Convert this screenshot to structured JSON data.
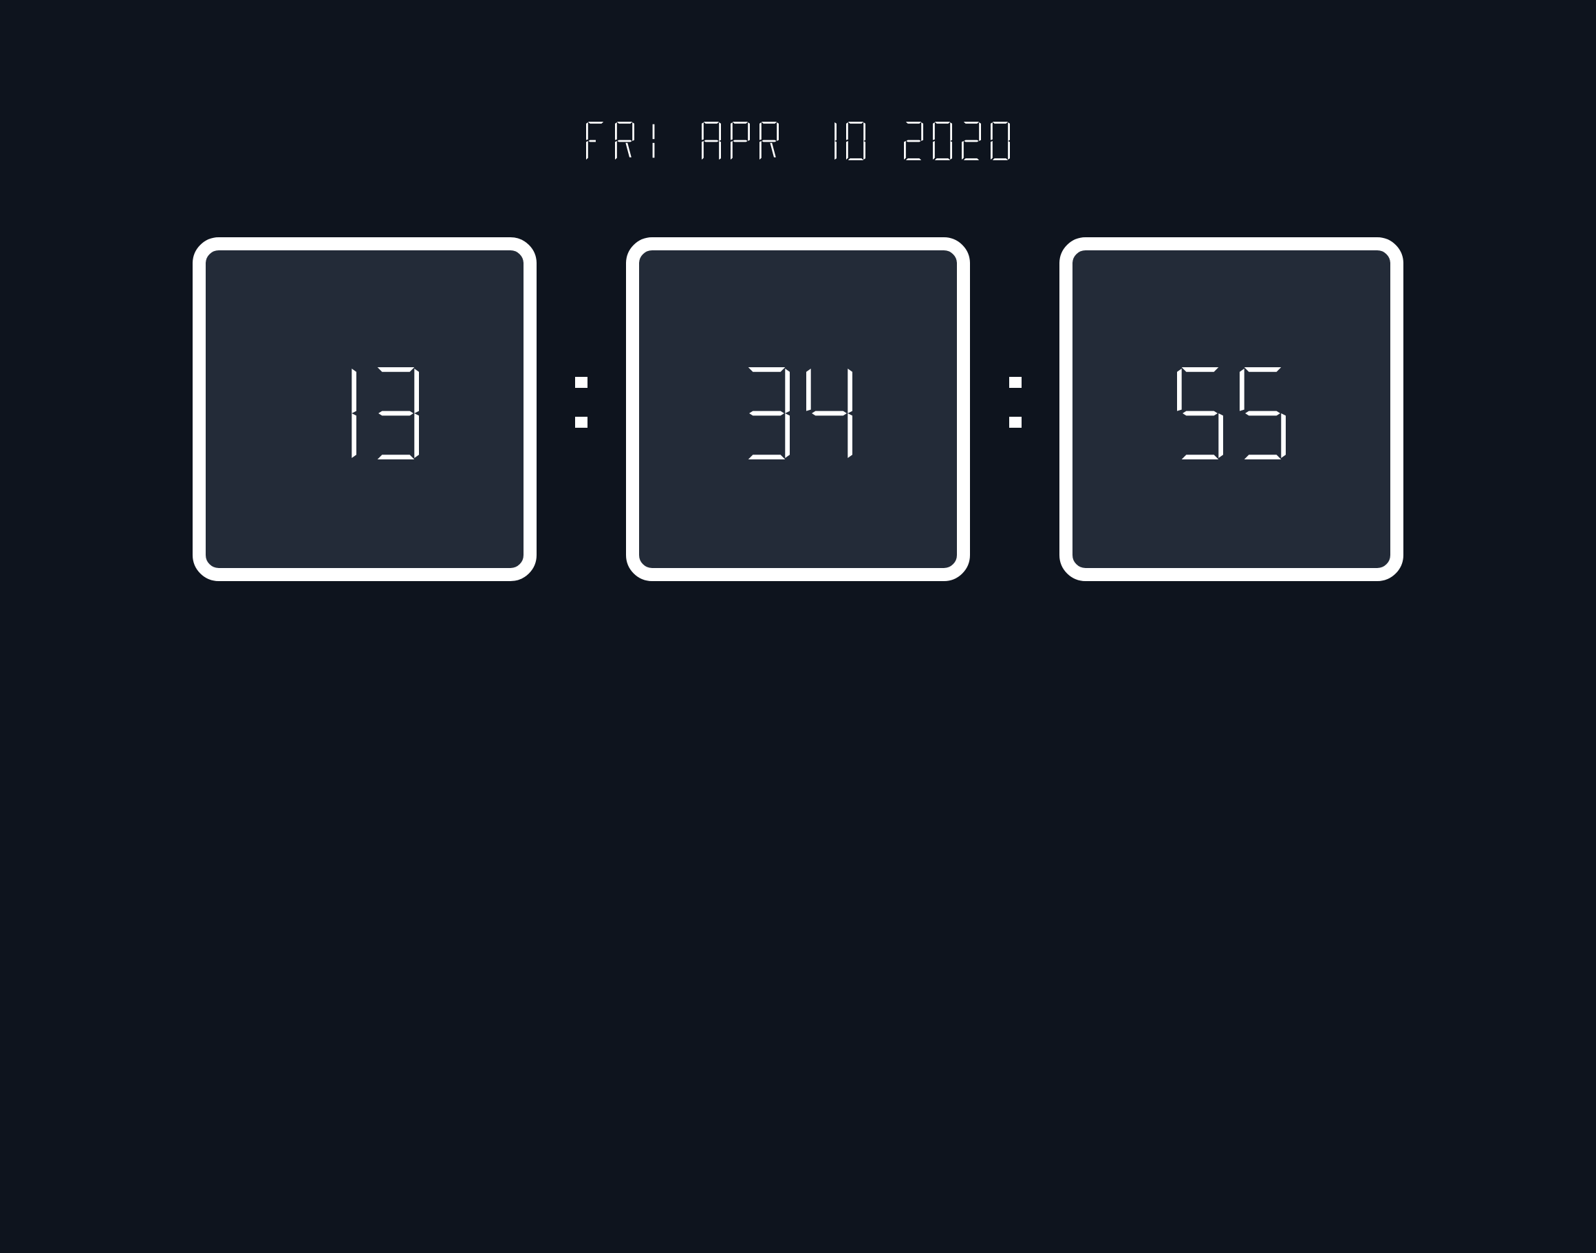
{
  "clock": {
    "date": "FRI APR 10 2020",
    "hours": "13",
    "minutes": "34",
    "seconds": "55",
    "separator": ":"
  },
  "colors": {
    "background": "#0e141e",
    "panel": "#232b38",
    "foreground": "#ffffff"
  }
}
